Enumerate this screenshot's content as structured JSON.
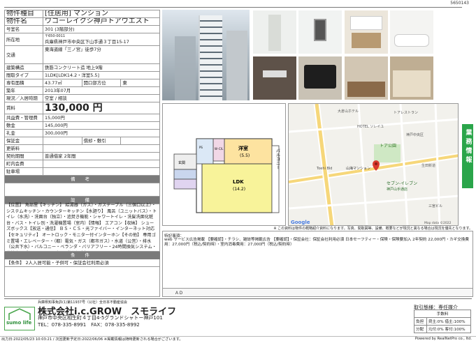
{
  "doc_id": "5650143",
  "property": {
    "type_label": "物件種目",
    "type_value": "[住居用] マンション",
    "name_label": "物件名",
    "name_value": "ワコーレイクシ神戸トアウエスト",
    "room_label": "号室名",
    "room_value": "301 (3階部分)",
    "address_label": "所在地",
    "postal": "〒650-0011",
    "address_value": "兵庫県神戸市中央区下山手通３丁目15-17",
    "transport_label": "交通",
    "transport_value": "東海道線「三ノ宮」徒歩7分",
    "structure_label": "建築構造",
    "structure_value": "鉄筋コンクリート造 地上9階",
    "layout_label": "間取タイプ",
    "layout_value": "1LDK[LDK14.2・洋室5.5]",
    "area_label": "専有面積",
    "area_value": "43.77㎡",
    "orientation_label": "開口部方位",
    "orientation_value": "東",
    "built_label": "築年",
    "built_value": "2013年07月",
    "status_label": "現況／入居時期",
    "status_value": "空室 / 相談",
    "rent_label": "賃料",
    "rent_value": "130,000 円",
    "fee_label": "共益費・管理費",
    "fee_value": "15,000円",
    "deposit_label": "敷金",
    "deposit_value": "145,000円",
    "keymoney_label": "礼金",
    "keymoney_value": "300,000円",
    "guarantee_label": "保証金",
    "deduction_label": "償却・敷引",
    "renewal_label": "更新料",
    "contract_label": "契約期間",
    "contract_value": "普通借家 2年間",
    "association_label": "町内会費",
    "parking_label": "駐車場"
  },
  "remarks_header": "備 考",
  "equipment_header": "設 備",
  "equipment_text": "【位置】 角部屋【キッチン】 給湯器（ガス）・ガステーブル（三個口以上）・システムキッチン・カウンターキッチン【水廻り】 風呂（ユニットバス）・トイレ（水洗）・洗面台（独立）・追焚き機能・シャワートイレ・洗髪洗面化粧台・バス・トイレ別・洗濯機置場（室内）【情報】 エアコン【収納】 シューズボックス【放送・通信】 ＢＳ・ＣＳ・光ファイバー・インターネット対応【セキュリティ】 オートロック・モニター付インターホン【その他】 専用ゴミ置場・エレベーター・（都）電気・ガス（都市ガス）・水道（公営）・排水（公共下水）・バルコニー・ベランダ・バリアフリー・24時間換気システム・分譲タイプ・フローリング・日当たり良好",
  "conditions_header": "条 件",
  "conditions_text": "【条件】 2人入居可能・子供可・保証会社利用必須",
  "floorplan": {
    "western_label": "洋室",
    "western_size": "(5.5)",
    "ldk_label": "LDK",
    "ldk_size": "(14.2)",
    "balcony_label": "バルコニー",
    "wic_label": "W･C/L",
    "pass_label": "PS",
    "entry_label": "玄関"
  },
  "map": {
    "labels": [
      "神戸中央区",
      "大倉山ホテル",
      "トアレストラン",
      "HOTEL ソレイユ",
      "トア公園",
      "山海マンション",
      "Toehi Bld",
      "セブン-イレブン",
      "神戸山手通店",
      "生田新道",
      "三宮ビル",
      "Google"
    ],
    "copyright": "Map data ©2022"
  },
  "note_text": "※ この資料は物件の概略紹介資料になります。写真、間取図等、設備、概要などが現況と異なる場合は現況を優先となります。",
  "special_label": "特記事項：",
  "special_text": "web サービス広告掲載 【要確認】・チラシ、雑誌等掲載広告 【要確認】・保証会社：保証会社利用必須 日本セーフティー・保険・保険要加入 2年契約 22,000円・カギ交換費用：27,000円（税込/契約時）・室内消毒費用：27,000円（税込/契約時）",
  "ad_label": "ＡＤ",
  "side_tab": "業務情報",
  "company": {
    "license": "兵庫県知事免許(1)第11937号（公社）全日本不動産協会",
    "name": "株式会社i.c.GROW　スモライフ",
    "address": "神戸市中央区相生町４丁目4-5グランドシャトー神戸101",
    "phone": "TEL：078-335-8991　FAX：078-335-8992",
    "logo_text": "sumo life"
  },
  "deal": {
    "header": "取引態様：専任媒介",
    "sub": "手数料",
    "rows": [
      {
        "k": "負担",
        "v": "貸主:0%  借主:100%"
      },
      {
        "k": "分配",
        "v": "元付:0%  客付:100%"
      }
    ]
  },
  "footer": {
    "issued": "出力日:2022/05/23 10:03:21 / 次回更新予定日:2022/06/06 ※掲載情報は随時更新される場合がございます。",
    "powered": "Powered by RealNetPro co., ltd."
  }
}
